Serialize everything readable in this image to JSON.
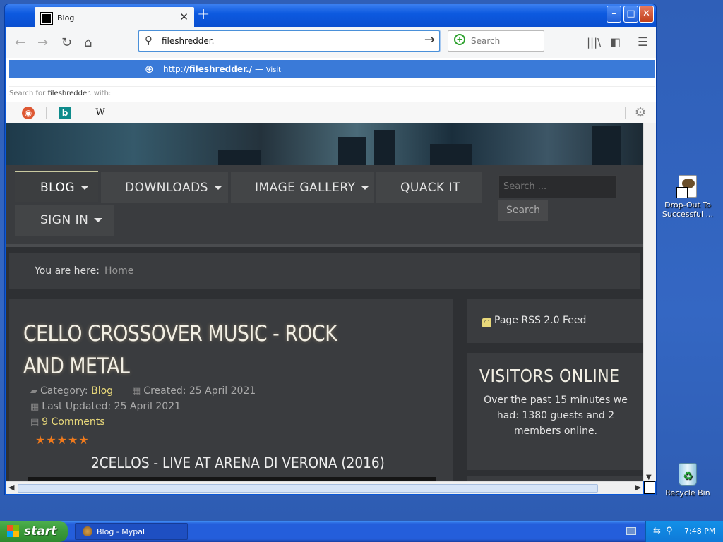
{
  "browser": {
    "tab_title": "Blog",
    "url_input_value": "fileshredder.",
    "search_placeholder": "Search",
    "suggestion": {
      "prefix": "http://",
      "host": "fileshredder./",
      "separator": " — ",
      "action": "Visit"
    },
    "search_for": {
      "prefix": "Search for ",
      "term": "fileshredder.",
      "suffix": " with:"
    }
  },
  "site": {
    "menu": [
      {
        "label": "BLOG"
      },
      {
        "label": "DOWNLOADS"
      },
      {
        "label": "IMAGE GALLERY"
      },
      {
        "label": "QUACK IT"
      },
      {
        "label": "SIGN IN"
      }
    ],
    "search_placeholder": "Search ...",
    "search_button": "Search",
    "breadcrumb": {
      "label": "You are here:",
      "home": "Home"
    },
    "article": {
      "title": "CELLO CROSSOVER MUSIC - ROCK AND METAL",
      "category_label": "Category:",
      "category": "Blog",
      "created": "Created: 25 April 2021",
      "updated": "Last Updated: 25 April 2021",
      "comments": "9 Comments",
      "rating_stars": 5,
      "subtitle": "2CELLOS - LIVE AT ARENA DI VERONA (2016)"
    },
    "rss": "Page RSS 2.0 Feed",
    "visitors": {
      "title": "VISITORS ONLINE",
      "text": "Over the past 15 minutes we had: 1380 guests and 2 members online."
    }
  },
  "desktop": {
    "icon1_label": "Drop-Out To Successful ...",
    "icon2_label": "Recycle Bin"
  },
  "taskbar": {
    "start_label": "start",
    "task_label": "Blog - Mypal",
    "clock": "7:48 PM"
  },
  "colors": {
    "accent": "#3a7ad8",
    "link": "#e8d87a",
    "stars": "#f07a1c"
  }
}
